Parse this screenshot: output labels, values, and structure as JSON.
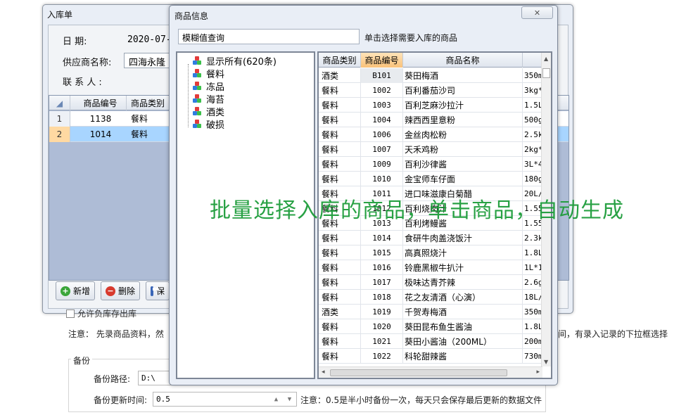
{
  "background": {
    "note": "注意：   先录商品资料，然",
    "note_right": "间，有录入记录的下拉框选择",
    "checkbox_label": "允许负库存出库",
    "backup": {
      "legend": "备份",
      "path_label": "备份路径:",
      "path_value": "D:\\",
      "interval_label": "备份更新时间:",
      "interval_value": "0.5",
      "note": "注意：0.5是半小时备份一次，每天只会保存最后更新的数据文件"
    }
  },
  "receipt_window": {
    "title": "入库单",
    "date_label": "日      期:",
    "date_value": "2020-07-",
    "supplier_label": "供应商名称:",
    "supplier_value": "四海永隆",
    "contact_label": "联 系 人 :",
    "columns": [
      "商品编号",
      "商品类别"
    ],
    "rows": [
      {
        "num": "1",
        "code": "1138",
        "category": "餐料"
      },
      {
        "num": "2",
        "code": "1014",
        "category": "餐料"
      }
    ],
    "buttons": {
      "add": "新增",
      "delete": "删除",
      "save": "保"
    }
  },
  "product_window": {
    "title": "商品信息",
    "close_glyph": "✕",
    "search_value": "模糊值查询",
    "hint": "单击选择需要入库的商品",
    "tree": [
      {
        "label": "显示所有(620条)"
      },
      {
        "label": "餐料"
      },
      {
        "label": "冻品"
      },
      {
        "label": "海苔"
      },
      {
        "label": "酒类"
      },
      {
        "label": "破损"
      }
    ],
    "columns": [
      "商品类别",
      "商品编号",
      "商品名称",
      ""
    ],
    "rows": [
      {
        "cat": "酒类",
        "code": "B101",
        "name": "葵田梅酒",
        "spec": "350m"
      },
      {
        "cat": "餐料",
        "code": "1002",
        "name": "百利番茄沙司",
        "spec": "3kg*"
      },
      {
        "cat": "餐料",
        "code": "1003",
        "name": "百利芝麻沙拉汁",
        "spec": "1.5L"
      },
      {
        "cat": "餐料",
        "code": "1004",
        "name": "辣西西里意粉",
        "spec": "500g"
      },
      {
        "cat": "餐料",
        "code": "1006",
        "name": "金丝肉松粉",
        "spec": "2.5k"
      },
      {
        "cat": "餐料",
        "code": "1007",
        "name": "天禾鸡粉",
        "spec": "2kg*"
      },
      {
        "cat": "餐料",
        "code": "1009",
        "name": "百利沙律酱",
        "spec": "3L*4"
      },
      {
        "cat": "餐料",
        "code": "1010",
        "name": "金宝师车仔面",
        "spec": "180g"
      },
      {
        "cat": "餐料",
        "code": "1011",
        "name": "进口味滋康白菊醋",
        "spec": "20L/"
      },
      {
        "cat": "餐料",
        "code": "1012",
        "name": "百利烧肉汁",
        "spec": "1.55"
      },
      {
        "cat": "餐料",
        "code": "1013",
        "name": "百利烤鳗酱",
        "spec": "1.55"
      },
      {
        "cat": "餐料",
        "code": "1014",
        "name": "食研牛肉盖浇饭汁",
        "spec": "2.3k"
      },
      {
        "cat": "餐料",
        "code": "1015",
        "name": "高真照烧汁",
        "spec": "1.8L"
      },
      {
        "cat": "餐料",
        "code": "1016",
        "name": "铃鹿黑椒牛扒汁",
        "spec": "1L*1"
      },
      {
        "cat": "餐料",
        "code": "1017",
        "name": "极味达青芥辣",
        "spec": "2.6g"
      },
      {
        "cat": "餐料",
        "code": "1018",
        "name": "花之友清酒（心演）",
        "spec": "18L/"
      },
      {
        "cat": "酒类",
        "code": "1019",
        "name": "千贺寿梅酒",
        "spec": "350m"
      },
      {
        "cat": "餐料",
        "code": "1020",
        "name": "葵田昆布鱼生酱油",
        "spec": "1.8L"
      },
      {
        "cat": "餐料",
        "code": "1021",
        "name": "葵田小酱油（200ML）",
        "spec": "200m"
      },
      {
        "cat": "餐料",
        "code": "1022",
        "name": "科轮甜辣酱",
        "spec": "730m"
      }
    ]
  },
  "overlay_caption": "批量选择入库的商品，单击商品，自动生成",
  "colors": {
    "overlay": "#1d9c3a",
    "selected_row": "#a8d5ff",
    "selected_header": "#f9c27a"
  }
}
